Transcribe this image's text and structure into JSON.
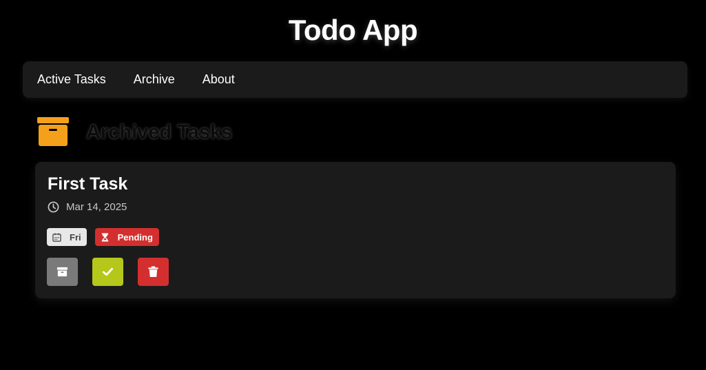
{
  "app": {
    "title": "Todo App"
  },
  "nav": {
    "items": [
      {
        "label": "Active Tasks"
      },
      {
        "label": "Archive"
      },
      {
        "label": "About"
      }
    ]
  },
  "section": {
    "title": "Archived Tasks",
    "icon": "archive-box-icon",
    "icon_color": "#f5a01a"
  },
  "tasks": [
    {
      "title": "First Task",
      "date": "Mar 14, 2025",
      "day_badge": "Fri",
      "status_badge": "Pending",
      "status_color": "#d32f2f",
      "actions": [
        {
          "icon": "archive-icon",
          "color": "#7a7a7a"
        },
        {
          "icon": "check-icon",
          "color": "#b5c71a"
        },
        {
          "icon": "trash-icon",
          "color": "#d32f2f"
        }
      ]
    }
  ]
}
